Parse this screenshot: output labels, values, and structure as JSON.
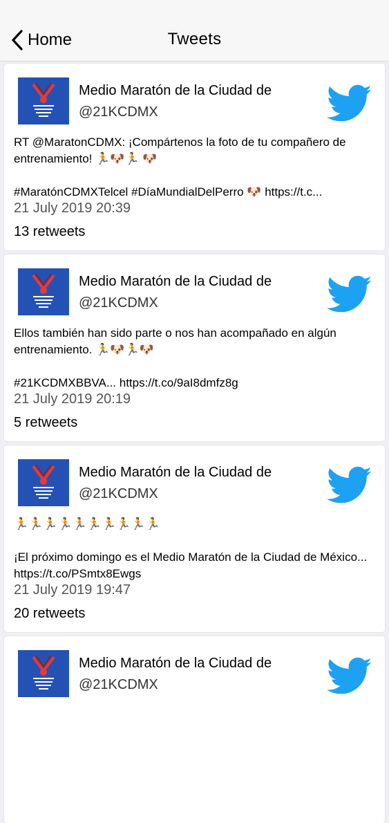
{
  "nav": {
    "back_label": "Home",
    "title": "Tweets"
  },
  "colors": {
    "twitter_blue": "#1da1f2",
    "avatar_bg": "#2452b4"
  },
  "tweets": [
    {
      "name": "Medio Maratón de la Ciudad de",
      "handle": "@21KCDMX",
      "text": "RT @MaratonCDMX: ¡Compártenos la foto de tu compañero de entrenamiento! 🏃🐶🏃 🐶\n\n#MaratónCDMXTelcel #DíaMundialDelPerro 🐶 https://t.c...",
      "date": "21 July 2019 20:39",
      "retweets": "13 retweets"
    },
    {
      "name": "Medio Maratón de la Ciudad de",
      "handle": "@21KCDMX",
      "text": "Ellos también han sido parte o nos han acompañado en algún entrenamiento. 🏃🐶🏃🐶\n\n#21KCDMXBBVA... https://t.co/9aI8dmfz8g",
      "date": "21 July 2019 20:19",
      "retweets": "5 retweets"
    },
    {
      "name": "Medio Maratón de la Ciudad de",
      "handle": "@21KCDMX",
      "text": "🏃🏃🏃🏃🏃🏃🏃🏃🏃🏃\n\n¡El próximo domingo es el Medio Maratón de la Ciudad de México... https://t.co/PSmtx8Ewgs",
      "date": "21 July 2019 19:47",
      "retweets": "20 retweets"
    },
    {
      "name": "Medio Maratón de la Ciudad de",
      "handle": "@21KCDMX",
      "text": "",
      "date": "",
      "retweets": ""
    }
  ]
}
